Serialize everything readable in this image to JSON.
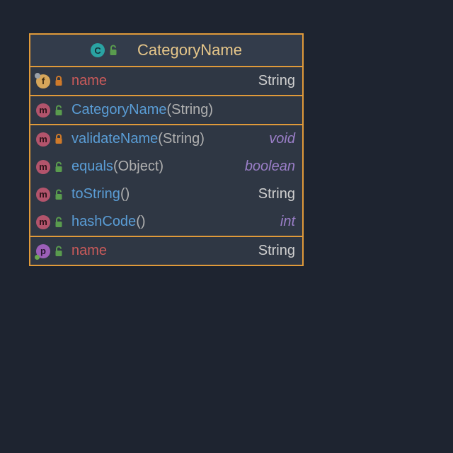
{
  "class": {
    "title": "CategoryName",
    "kind": "class"
  },
  "fields": [
    {
      "badge": "f",
      "vis": "private",
      "name": "name",
      "type": "String",
      "typeStyle": "plain",
      "nameStyle": "red"
    }
  ],
  "constructors": [
    {
      "badge": "m",
      "vis": "public",
      "name": "CategoryName",
      "params": "(String)",
      "type": "",
      "typeStyle": ""
    }
  ],
  "methods": [
    {
      "badge": "m",
      "vis": "private",
      "name": "validateName",
      "params": "(String)",
      "type": "void",
      "typeStyle": "it"
    },
    {
      "badge": "m",
      "vis": "public",
      "name": "equals",
      "params": "(Object)",
      "type": "boolean",
      "typeStyle": "it"
    },
    {
      "badge": "m",
      "vis": "public",
      "name": "toString",
      "params": "()",
      "type": "String",
      "typeStyle": "plain"
    },
    {
      "badge": "m",
      "vis": "public",
      "name": "hashCode",
      "params": "()",
      "type": "int",
      "typeStyle": "it"
    }
  ],
  "properties": [
    {
      "badge": "p",
      "vis": "public",
      "name": "name",
      "type": "String",
      "typeStyle": "plain",
      "nameStyle": "red"
    }
  ],
  "badgeLetters": {
    "c": "C",
    "f": "f",
    "m": "m",
    "p": "p"
  },
  "colors": {
    "locked": "#cf7a2a",
    "unlocked": "#5a9c4e"
  }
}
